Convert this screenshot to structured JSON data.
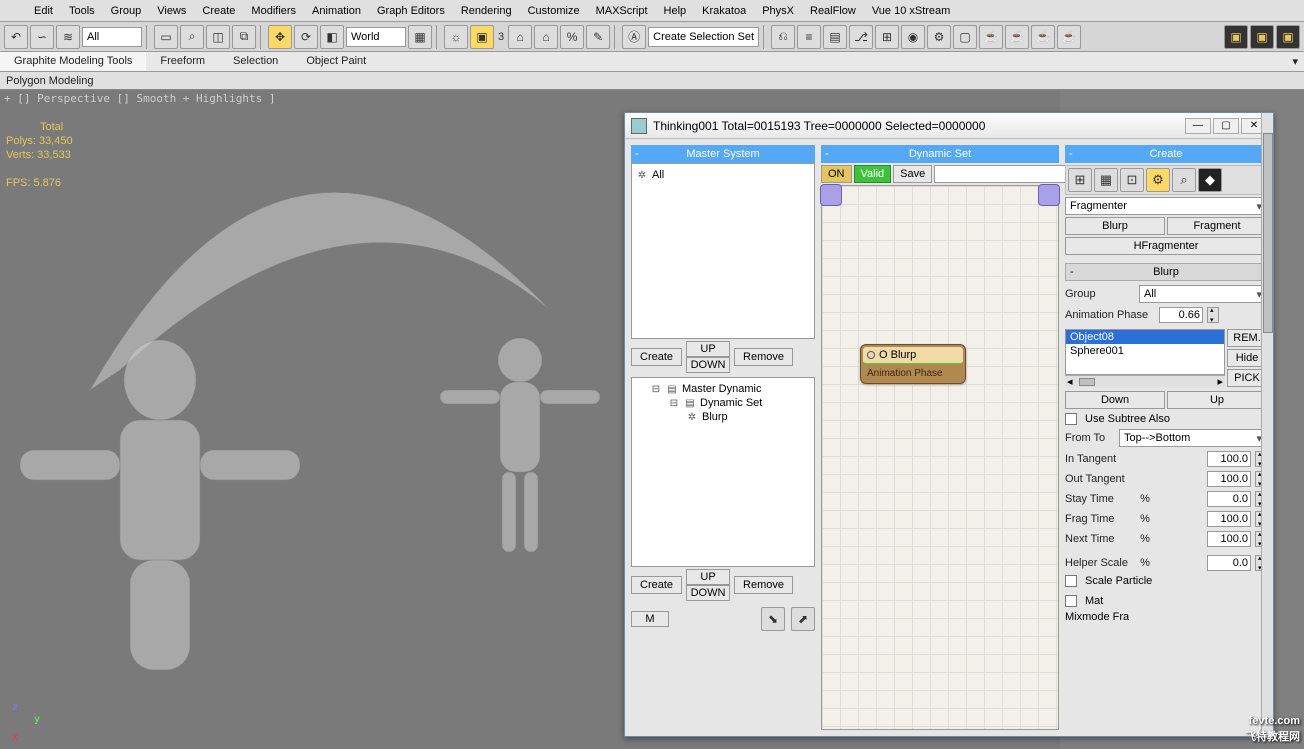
{
  "menu": [
    "Edit",
    "Tools",
    "Group",
    "Views",
    "Create",
    "Modifiers",
    "Animation",
    "Graph Editors",
    "Rendering",
    "Customize",
    "MAXScript",
    "Help",
    "Krakatoa",
    "PhysX",
    "RealFlow",
    "Vue 10 xStream"
  ],
  "toolbar": {
    "dropdown_all": "All",
    "coord_system": "World",
    "sel_set": "Create Selection Set",
    "label_3": "3"
  },
  "ribbon": {
    "tabs": [
      "Graphite Modeling Tools",
      "Freeform",
      "Selection",
      "Object Paint"
    ],
    "sub": "Polygon Modeling"
  },
  "viewport": {
    "label": "+ [] Perspective [] Smooth + Highlights ]",
    "stats": {
      "total": "Total",
      "polys": "Polys: 33,450",
      "verts": "Verts: 33,533",
      "fps": "FPS:   5.876"
    },
    "axes": {
      "x": "x",
      "y": "y",
      "z": "z"
    }
  },
  "thinking": {
    "title": "Thinking001  Total=0015193  Tree=0000000  Selected=0000000",
    "left": {
      "master_header": "Master System",
      "all": "All",
      "create": "Create",
      "up": "UP",
      "down": "DOWN",
      "remove": "Remove",
      "tree": {
        "n1": "Master Dynamic",
        "n2": "Dynamic Set",
        "n3": "Blurp"
      },
      "m": "M"
    },
    "mid": {
      "header": "Dynamic Set",
      "on": "ON",
      "valid": "Valid",
      "save": "Save",
      "node_title": "O Blurp",
      "node_sub": "Animation Phase"
    },
    "right": {
      "create_header": "Create",
      "fragmenter_dd": "Fragmenter",
      "blurp": "Blurp",
      "fragment": "Fragment",
      "hfragmenter": "HFragmenter",
      "blurp_header": "Blurp",
      "group": "Group",
      "group_dd": "All",
      "anim_phase": "Animation Phase",
      "anim_phase_val": "0.66",
      "obj1": "Object08",
      "obj2": "Sphere001",
      "rem": "REM.",
      "hide": "Hide",
      "pick": "PICK",
      "down_btn": "Down",
      "up_btn": "Up",
      "use_subtree": "Use Subtree Also",
      "fromto": "From To",
      "fromto_dd": "Top-->Bottom",
      "in_tan": "In Tangent",
      "out_tan": "Out Tangent",
      "stay": "Stay Time",
      "frag": "Frag Time",
      "next": "Next Time",
      "val_100": "100.0",
      "val_0": "0.0",
      "pct": "%",
      "helper_scale": "Helper Scale",
      "helper_val": "0.0",
      "scale_particle": "Scale Particle",
      "mat": "Mat",
      "mixmode": "Mixmode Fra"
    }
  },
  "watermark": {
    "l1": "fevte.com",
    "l2": "飞特教程网"
  }
}
